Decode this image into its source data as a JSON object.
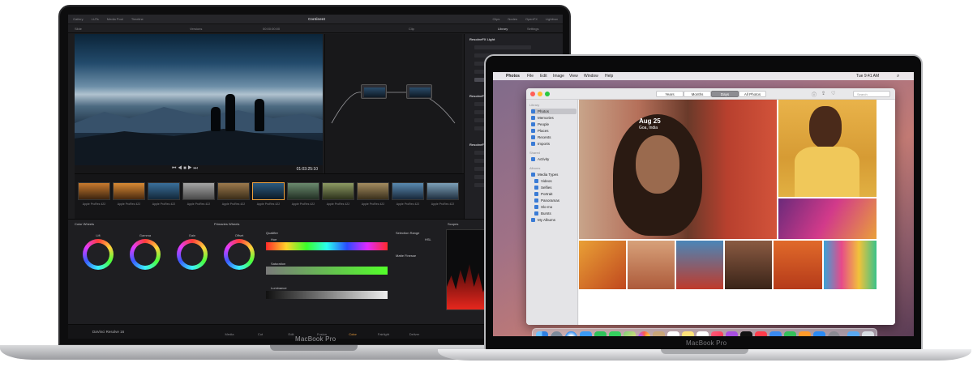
{
  "large_laptop": {
    "brand": "MacBook Pro",
    "app_title": "Continent",
    "top_tabs": [
      "Gallery",
      "LUTs",
      "Media Pool",
      "Timeline"
    ],
    "top_right_tabs": [
      "Clips",
      "Nodes",
      "OpenFX",
      "Lightbox"
    ],
    "sub_labels": {
      "left": "Slide",
      "zoom": "Versions",
      "timecode": "00:00:00:00",
      "clip": "Clip"
    },
    "timecode": "01:03:25:10",
    "panel_right": {
      "tab_library": "Library",
      "tab_settings": "Settings",
      "sections": [
        "ResolveFX Light",
        "ResolveFX Refine",
        "ResolveFX Revival"
      ]
    },
    "thumb_label": "Apple ProRes 422",
    "color_panel": {
      "section_titles": [
        "Color Wheels",
        "Primaries Wheels",
        "Qualifier",
        "Selection Range",
        "Scopes"
      ],
      "wheel_labels": [
        "Lift",
        "Gamma",
        "Gain",
        "Offset"
      ],
      "qualifier_labels": [
        "Hue",
        "Saturation",
        "Luminance"
      ],
      "hsl_label": "HSL",
      "matte_finesse": "Matte Finesse"
    },
    "bottom_nav": {
      "app_name": "DaVinci Resolve 16",
      "items": [
        "Media",
        "Cut",
        "Edit",
        "Fusion",
        "Color",
        "Fairlight",
        "Deliver"
      ],
      "active_index": 4
    }
  },
  "small_laptop": {
    "brand": "MacBook Pro",
    "menubar": {
      "app": "Photos",
      "items": [
        "File",
        "Edit",
        "Image",
        "View",
        "Window",
        "Help"
      ],
      "clock": "Tue 9:41 AM"
    },
    "photos": {
      "view_tabs": [
        "Years",
        "Months",
        "Days",
        "All Photos"
      ],
      "active_tab_index": 2,
      "search_placeholder": "Search",
      "date_overlay": "Aug 25",
      "place_overlay": "Goa, India",
      "sidebar": {
        "library_header": "Library",
        "library_items": [
          "Photos",
          "Memories",
          "People",
          "Places",
          "Recents",
          "Imports"
        ],
        "shared_header": "Shared",
        "shared_items": [
          "Activity"
        ],
        "albums_header": "Albums",
        "album_items": [
          "Media Types",
          "Videos",
          "Selfies",
          "Portrait",
          "Panoramas",
          "Slo-mo",
          "Bursts",
          "My Albums"
        ],
        "selected_index": 0
      }
    },
    "dock_icons": [
      "finder-icon",
      "launchpad-icon",
      "safari-icon",
      "mail-icon",
      "facetime-icon",
      "messages-icon",
      "maps-icon",
      "photos-icon",
      "contacts-icon",
      "calendar-icon",
      "notes-icon",
      "reminders-icon",
      "music-icon",
      "podcasts-icon",
      "tv-icon",
      "news-icon",
      "keynote-icon",
      "numbers-icon",
      "pages-icon",
      "appstore-icon",
      "settings-icon",
      "folder-icon",
      "trash-icon"
    ]
  },
  "colors": {
    "resolve_accent": "#f0a13c",
    "photos_blue": "#3a7bd5",
    "silver": "#d9dadc"
  }
}
